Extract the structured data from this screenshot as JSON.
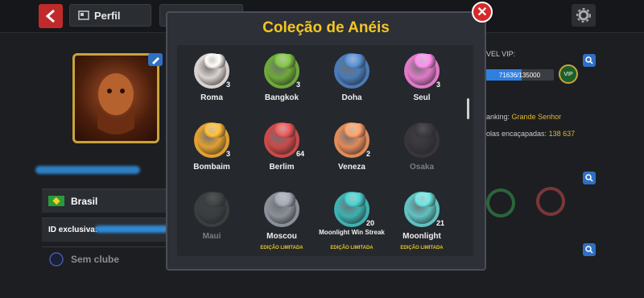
{
  "header": {
    "profile_tab": "Perfil"
  },
  "left": {
    "country": "Brasil",
    "id_label": "ID exclusiva:",
    "club": "Sem clube"
  },
  "right": {
    "vip_label": "VEL VIP:",
    "vip_progress_text": "71636/135000",
    "vip_progress_fraction": 0.53,
    "vip_badge": "VIP",
    "ranking_label": "anking:",
    "ranking_value": "Grande Senhor",
    "pocketed_label": "olas encaçapadas:",
    "pocketed_value": "138 637"
  },
  "modal": {
    "title": "Coleção de Anéis",
    "rings": [
      {
        "name": "Roma",
        "count": "3",
        "color": "#d9d2cf",
        "locked": false,
        "limited": ""
      },
      {
        "name": "Bangkok",
        "count": "3",
        "color": "#6ea83a",
        "locked": false,
        "limited": ""
      },
      {
        "name": "Doha",
        "count": "",
        "color": "#4a7ab5",
        "locked": false,
        "limited": ""
      },
      {
        "name": "Seul",
        "count": "3",
        "color": "#e07ac8",
        "locked": false,
        "limited": ""
      },
      {
        "name": "Bombaim",
        "count": "3",
        "color": "#e0a032",
        "locked": false,
        "limited": ""
      },
      {
        "name": "Berlim",
        "count": "64",
        "color": "#c94a4a",
        "locked": false,
        "limited": ""
      },
      {
        "name": "Veneza",
        "count": "2",
        "color": "#e08a5a",
        "locked": false,
        "limited": ""
      },
      {
        "name": "Osaka",
        "count": "",
        "color": "#6a4a5a",
        "locked": true,
        "limited": ""
      },
      {
        "name": "Maui",
        "count": "",
        "color": "#5a6a58",
        "locked": true,
        "limited": ""
      },
      {
        "name": "Moscou",
        "count": "",
        "color": "#8a8f98",
        "locked": false,
        "limited": "EDIÇÃO LIMITADA"
      },
      {
        "name": "Moonlight Win Streak",
        "count": "20",
        "color": "#3fb0b0",
        "locked": false,
        "limited": "EDIÇÃO LIMITADA"
      },
      {
        "name": "Moonlight",
        "count": "21",
        "color": "#5fc2c0",
        "locked": false,
        "limited": "EDIÇÃO LIMITADA"
      }
    ]
  },
  "colors": {
    "accent_yellow": "#f3c623",
    "close_red": "#d62a2a",
    "back_red": "#c02a2a"
  }
}
